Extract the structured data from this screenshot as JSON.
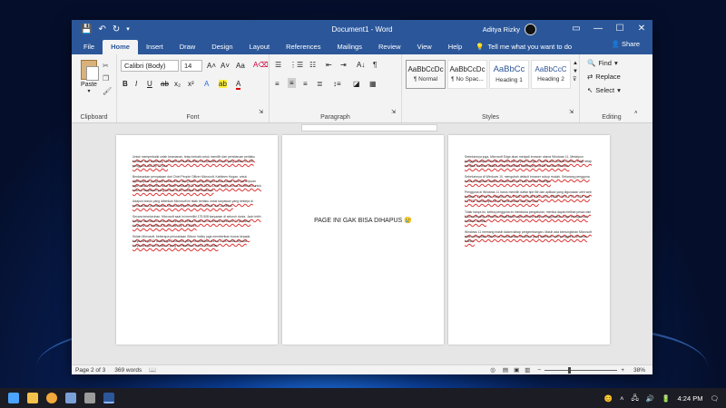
{
  "window": {
    "doc_title": "Document1 - Word",
    "user_name": "Aditya Rizky",
    "controls": [
      "—",
      "☐",
      "✕"
    ]
  },
  "qat": [
    "💾",
    "↶",
    "↻"
  ],
  "tabs": [
    "File",
    "Home",
    "Insert",
    "Draw",
    "Design",
    "Layout",
    "References",
    "Mailings",
    "Review",
    "View",
    "Help"
  ],
  "tell_me": "Tell me what you want to do",
  "share": "Share",
  "ribbon": {
    "clipboard": {
      "paste": "Paste",
      "label": "Clipboard"
    },
    "font": {
      "name": "Calibri (Body)",
      "size": "14",
      "label": "Font",
      "bold": "B",
      "italic": "I",
      "underline": "U"
    },
    "paragraph": {
      "label": "Paragraph"
    },
    "styles": {
      "label": "Styles",
      "items": [
        {
          "preview": "AaBbCcDc",
          "name": "¶ Normal"
        },
        {
          "preview": "AaBbCcDc",
          "name": "¶ No Spac..."
        },
        {
          "preview": "AaBbCc",
          "name": "Heading 1"
        },
        {
          "preview": "AaBbCcC",
          "name": "Heading 2"
        }
      ]
    },
    "editing": {
      "find": "Find",
      "replace": "Replace",
      "select": "Select",
      "label": "Editing"
    }
  },
  "pages": {
    "page1": [
      "Untuk memperbaiki celah keamanan, tetap terbaik untuk memilih dari pembaruan perilaku browser dari sekarang. Microsoft kemudian telah memperbaiki bonus yang sudah 51.000 pengguna dan Rp 32 juta.",
      "Berdasarkan pernyataan dari Chief People Officer Microsoft, Kathleen Hogan, untuk dipersiapkan yang ada sekali untuk dan pilihan yang dengan sesar sudah cara perempuan agar masih tersedia mulai tahun sekarang 31 Maret 2020. Lebih lanjut, bonus ini berlaku untuk seluruh karyawan yang berada di AS maupun internasional.",
      "Adapun bonus yang diberikan Microsoft ini tidak berlaku untuk karyawan yang bekerja di perusahaan-perusahaan Microsoft seperti LinkedIn, Github, dan ZeniMax.",
      "Secara keseluruhan, Microsoft saat ini memiliki 175.508 karyawan di seluruh dunia. Jauh lebih banyak dari tahun-tahun sebelumnya. Ketika bulan lalu di antara Windows 11 pertama, karyawan ini sekitar 100 ribu dan Rp 1,8 triliun.",
      "Selain Microsoft, beberapa perusahaan Silicon Valley juga memberikan bonus kepada karyawannya. Di antaranya Facebook yang memberikan bonus 1.000 dollar kepada karyawannya dan Amazon yang memberikan bonus 300 dollar."
    ],
    "page2": "PAGE INI GAK BISA DIHAPUS 😢",
    "page3": [
      "Sebelumnya juga, Microsoft Edge akan menjadi browser utama Windows 11. Meskipun pengguna dapat memilih browser lain seperti Google Chrome dan Mozilla Firefox, Edge tetap menjadi browser default untuk membuka beberapa jenis file secara otomatis.",
      "Sebelumnya di Windows 10, mengubah default browser cukup mudah. Sekarang pengguna harus mengubah secara manual satu per satu melalui Settings.",
      "Pengguna di Windows 11 harus memilih daftar tipe file dan aplikasi yang digunakan oleh web browser. Tipe file itu meliputi HTM, HTML, PDF, SHTML, SVG, WEBP, XHT, FTP, HTTP, dan HTTPS. Semua tipe file ini harus diubah satu per satu.",
      "Tidak hanya itu, ketika pengguna ini membuka pengaturan, mereka dapat melihat pesan dari Microsoft yang mencoba meyakinkan agar mereka tetap menggunakan Edge sebagai web browser default.",
      "Windows 11 memang masih dalam tahap pengembangan. Masih ada kemungkinan Microsoft akan mengubah sistem ini berdasarkan feedback yang diberikan oleh pengguna Windows Insider."
    ]
  },
  "status": {
    "page": "Page 2 of 3",
    "words": "369 words",
    "zoom": "38%",
    "zoom_minus": "−",
    "zoom_plus": "+"
  },
  "taskbar": {
    "time": "4:24 PM"
  }
}
